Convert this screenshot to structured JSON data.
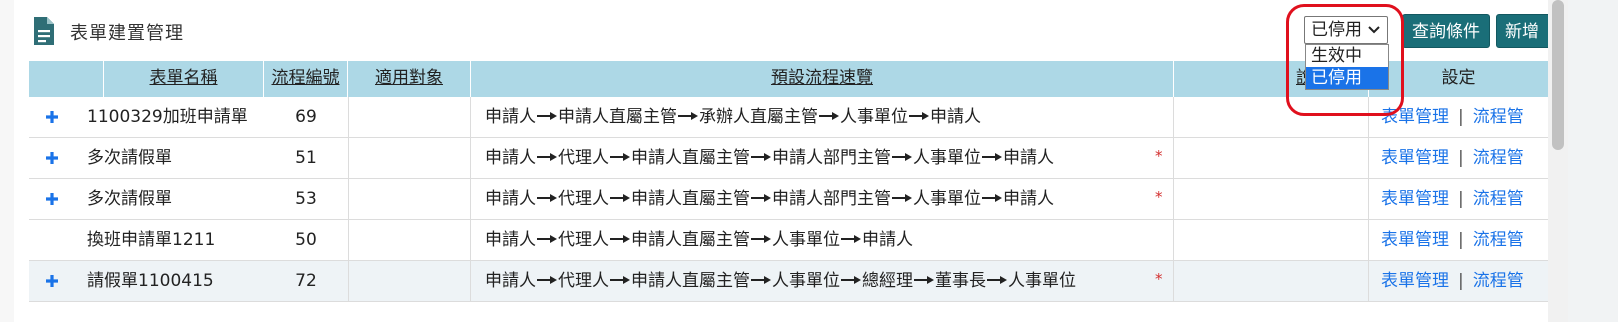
{
  "header": {
    "title": "表單建置管理",
    "icon": "document-icon",
    "status_select": {
      "value": "已停用",
      "options": [
        "生效中",
        "已停用"
      ],
      "selected_index": 1
    },
    "query_button": "查詢條件",
    "add_button": "新增"
  },
  "table": {
    "columns": [
      "表單名稱",
      "流程編號",
      "適用對象",
      "預設流程速覽",
      "說明",
      "設定"
    ],
    "rows": [
      {
        "expand": true,
        "name": "1100329加班申請單",
        "flow_no": "69",
        "target": "",
        "flow": [
          "申請人",
          "申請人直屬主管",
          "承辦人直屬主管",
          "人事單位",
          "申請人"
        ],
        "required": false,
        "note": ""
      },
      {
        "expand": true,
        "name": "多次請假單",
        "flow_no": "51",
        "target": "",
        "flow": [
          "申請人",
          "代理人",
          "申請人直屬主管",
          "申請人部門主管",
          "人事單位",
          "申請人"
        ],
        "required": true,
        "note": ""
      },
      {
        "expand": true,
        "name": "多次請假單",
        "flow_no": "53",
        "target": "",
        "flow": [
          "申請人",
          "代理人",
          "申請人直屬主管",
          "申請人部門主管",
          "人事單位",
          "申請人"
        ],
        "required": true,
        "note": ""
      },
      {
        "expand": false,
        "name": "換班申請單1211",
        "flow_no": "50",
        "target": "",
        "flow": [
          "申請人",
          "代理人",
          "申請人直屬主管",
          "人事單位",
          "申請人"
        ],
        "required": false,
        "note": ""
      },
      {
        "expand": true,
        "name": "請假單1100415",
        "flow_no": "72",
        "target": "",
        "flow": [
          "申請人",
          "代理人",
          "申請人直屬主管",
          "人事單位",
          "總經理",
          "董事長",
          "人事單位"
        ],
        "required": true,
        "note": ""
      }
    ],
    "row_actions": {
      "form_manage": "表單管理",
      "separator": "|",
      "flow_manage": "流程管"
    },
    "required_mark": "*"
  },
  "colors": {
    "header_bg": "#add8e6",
    "button_bg": "#1a6e78",
    "link": "#1a73e8",
    "plus": "#1a73e8",
    "highlight": "#e0101d",
    "required": "#d32f2f"
  }
}
